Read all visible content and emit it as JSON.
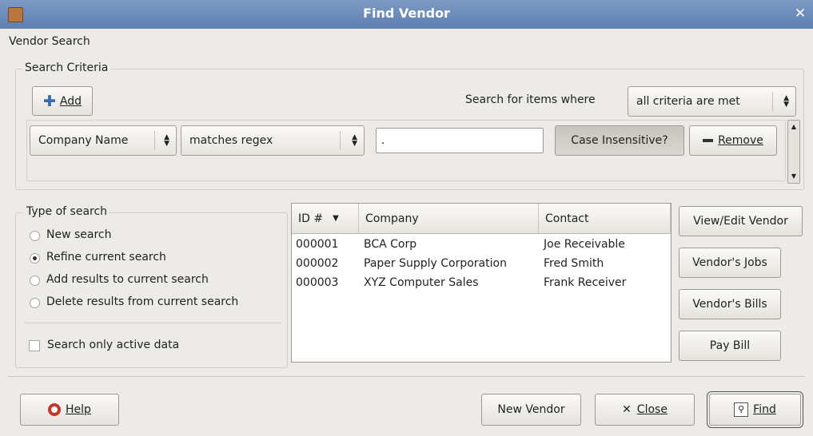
{
  "window": {
    "title": "Find Vendor"
  },
  "section_label": "Vendor Search",
  "criteria": {
    "group_title": "Search Criteria",
    "add_label": "Add",
    "search_for_label": "Search for items where",
    "match_mode": "all criteria are met",
    "row": {
      "field": "Company Name",
      "operator": "matches regex",
      "value": ".",
      "case_label": "Case Insensitive?",
      "remove_label": "Remove"
    }
  },
  "type_of_search": {
    "group_title": "Type of search",
    "options": [
      "New search",
      "Refine current search",
      "Add results to current search",
      "Delete results from current search"
    ],
    "selected": "Refine current search",
    "active_only_label": "Search only active data"
  },
  "results": {
    "columns": [
      "ID #",
      "Company",
      "Contact"
    ],
    "sort_column": "ID #",
    "rows": [
      {
        "id": "000001",
        "company": "BCA Corp",
        "contact": "Joe Receivable"
      },
      {
        "id": "000002",
        "company": "Paper Supply Corporation",
        "contact": "Fred Smith"
      },
      {
        "id": "000003",
        "company": "XYZ Computer Sales",
        "contact": "Frank Receiver"
      }
    ]
  },
  "actions": {
    "view_edit": "View/Edit Vendor",
    "jobs": "Vendor's Jobs",
    "bills": "Vendor's Bills",
    "pay_bill": "Pay Bill"
  },
  "footer": {
    "help": "Help",
    "new_vendor": "New Vendor",
    "close": "Close",
    "find": "Find"
  }
}
